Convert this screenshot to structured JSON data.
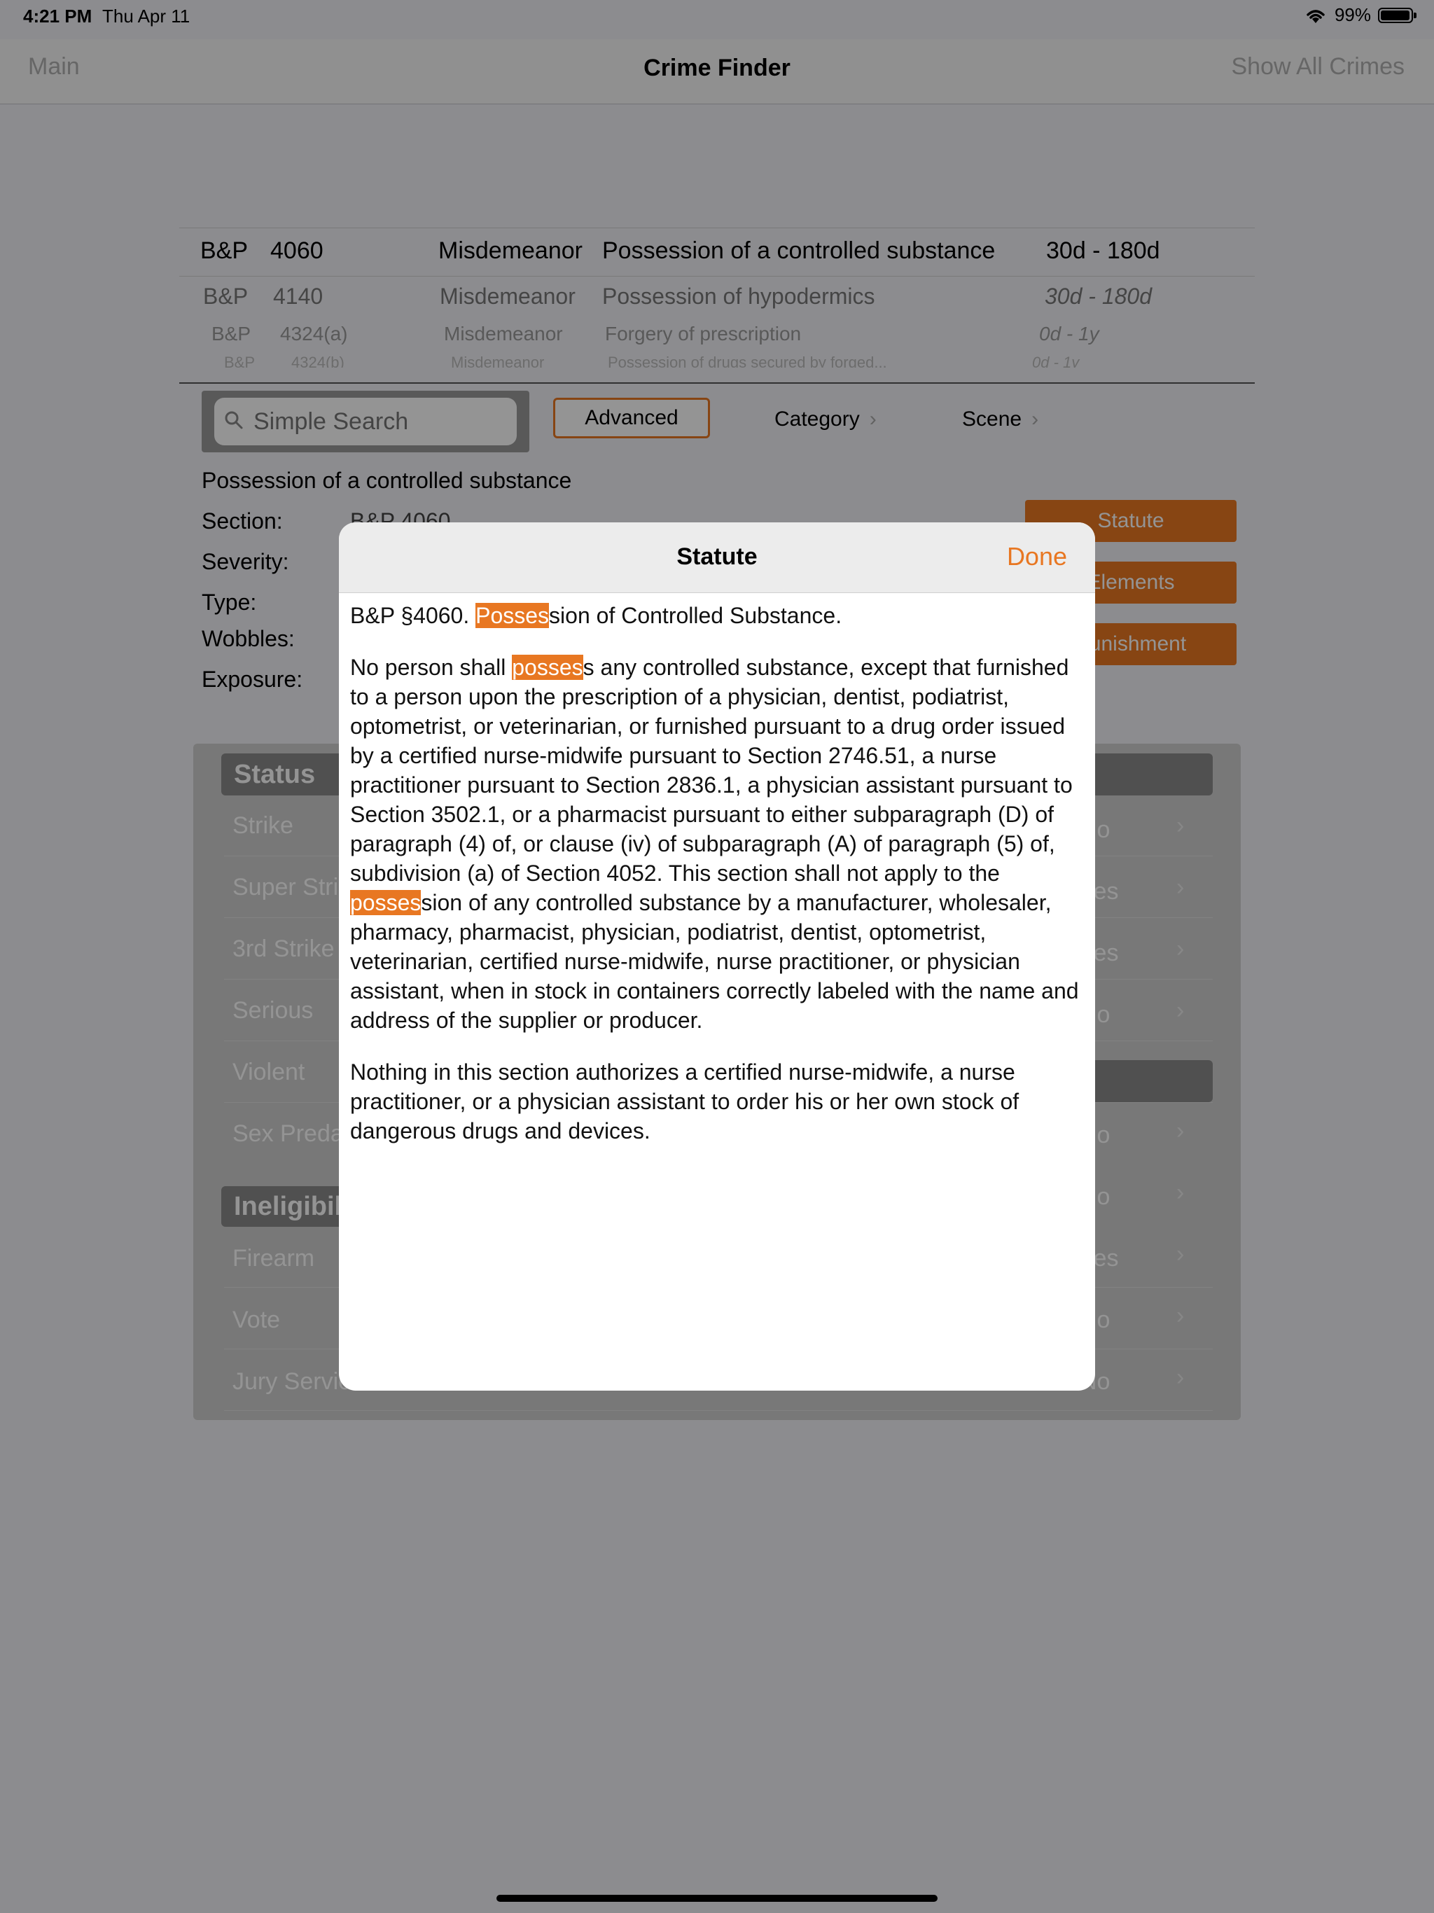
{
  "status_bar": {
    "time": "4:21 PM",
    "date": "Thu Apr 11",
    "battery": "99%"
  },
  "nav": {
    "left": "Main",
    "title": "Crime Finder",
    "right": "Show All Crimes"
  },
  "picker": {
    "rows": [
      {
        "code": "B&P",
        "section": "4060",
        "severity": "Misdemeanor",
        "title": "Possession of a controlled substance",
        "range": "30d - 180d"
      },
      {
        "code": "B&P",
        "section": "4140",
        "severity": "Misdemeanor",
        "title": "Possession of hypodermics",
        "range": "30d - 180d"
      },
      {
        "code": "B&P",
        "section": "4324(a)",
        "severity": "Misdemeanor",
        "title": "Forgery of prescription",
        "range": "0d - 1y"
      },
      {
        "code": "B&P",
        "section": "4324(b)",
        "severity": "Misdemeanor",
        "title": "Possession of drugs secured by forged...",
        "range": "0d - 1y"
      }
    ]
  },
  "search": {
    "placeholder": "Simple Search",
    "advanced": "Advanced",
    "category": "Category",
    "scene": "Scene"
  },
  "detail": {
    "title": "Possession of a controlled substance",
    "labels": {
      "section": "Section:",
      "severity": "Severity:",
      "type": "Type:",
      "wobbles": "Wobbles:",
      "exposure": "Exposure:"
    },
    "section_value": "B&P 4060",
    "buttons": {
      "statute": "Statute",
      "elements": "Elements",
      "punishment": "Punishment"
    }
  },
  "table": {
    "status_header": "Status",
    "status_rows": [
      "Strike",
      "Super Strike",
      "3rd Strike",
      "Serious",
      "Violent",
      "Sex Predator"
    ],
    "status_values": [
      "No",
      "Yes",
      "Yes",
      "No"
    ],
    "ineligible_header": "Ineligibility",
    "ineligible_rows": [
      "Firearm",
      "Vote",
      "Jury Service"
    ],
    "ineligible_values": [
      "No",
      "No",
      "Yes",
      "No",
      "No"
    ]
  },
  "modal": {
    "title": "Statute",
    "done": "Done",
    "p1_pre": "B&P §4060. ",
    "p1_hl": "Posses",
    "p1_post": "sion of Controlled Substance.",
    "p2_pre": "No person shall ",
    "p2_hl1": "posses",
    "p2_mid": "s any controlled substance, except that furnished to a person upon the prescription of a physician, dentist, podiatrist, optometrist, or veterinarian, or furnished pursuant to a drug order issued by a certified nurse-midwife pursuant to Section 2746.51, a nurse practitioner pursuant to Section 2836.1, a physician assistant pursuant to Section 3502.1, or a pharmacist pursuant to either subparagraph (D) of paragraph (4) of, or clause (iv) of subparagraph (A) of paragraph (5) of, subdivision (a) of Section 4052. This section shall not apply to the ",
    "p2_hl2": "posses",
    "p2_post": "sion of any controlled substance by a manufacturer, wholesaler, pharmacy, pharmacist, physician, podiatrist, dentist, optometrist, veterinarian, certified nurse-midwife, nurse practitioner, or physician assistant, when in stock in containers correctly labeled with the name and address of the supplier or producer.",
    "p3": "Nothing in this section authorizes a certified nurse-midwife, a nurse practitioner, or a physician assistant to order his or her own stock of dangerous drugs and devices."
  },
  "colors": {
    "accent": "#e87722"
  }
}
